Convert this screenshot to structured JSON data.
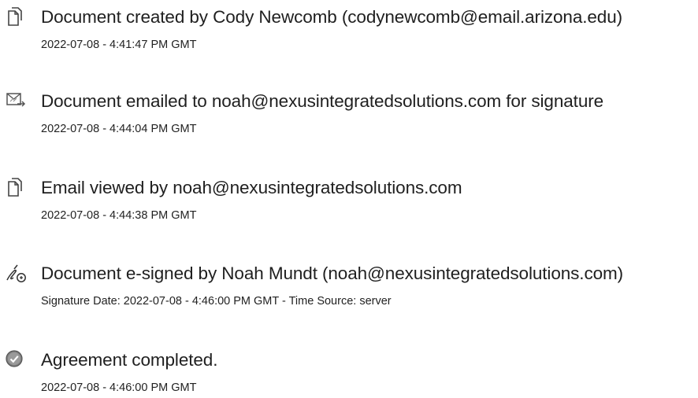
{
  "events": [
    {
      "icon": "document-icon",
      "title": "Document created by Cody Newcomb (codynewcomb@email.arizona.edu)",
      "stamp": "2022-07-08 - 4:41:47 PM GMT"
    },
    {
      "icon": "email-send-icon",
      "title": "Document emailed to noah@nexusintegratedsolutions.com for signature",
      "stamp": "2022-07-08 - 4:44:04 PM GMT"
    },
    {
      "icon": "document-icon",
      "title": "Email viewed by noah@nexusintegratedsolutions.com",
      "stamp": "2022-07-08 - 4:44:38 PM GMT"
    },
    {
      "icon": "pen-sign-icon",
      "title": "Document e-signed by Noah Mundt (noah@nexusintegratedsolutions.com)",
      "stamp": "Signature Date: 2022-07-08 - 4:46:00 PM GMT - Time Source: server"
    },
    {
      "icon": "check-circle-icon",
      "title": "Agreement completed.",
      "stamp": "2022-07-08 - 4:46:00 PM GMT"
    }
  ]
}
